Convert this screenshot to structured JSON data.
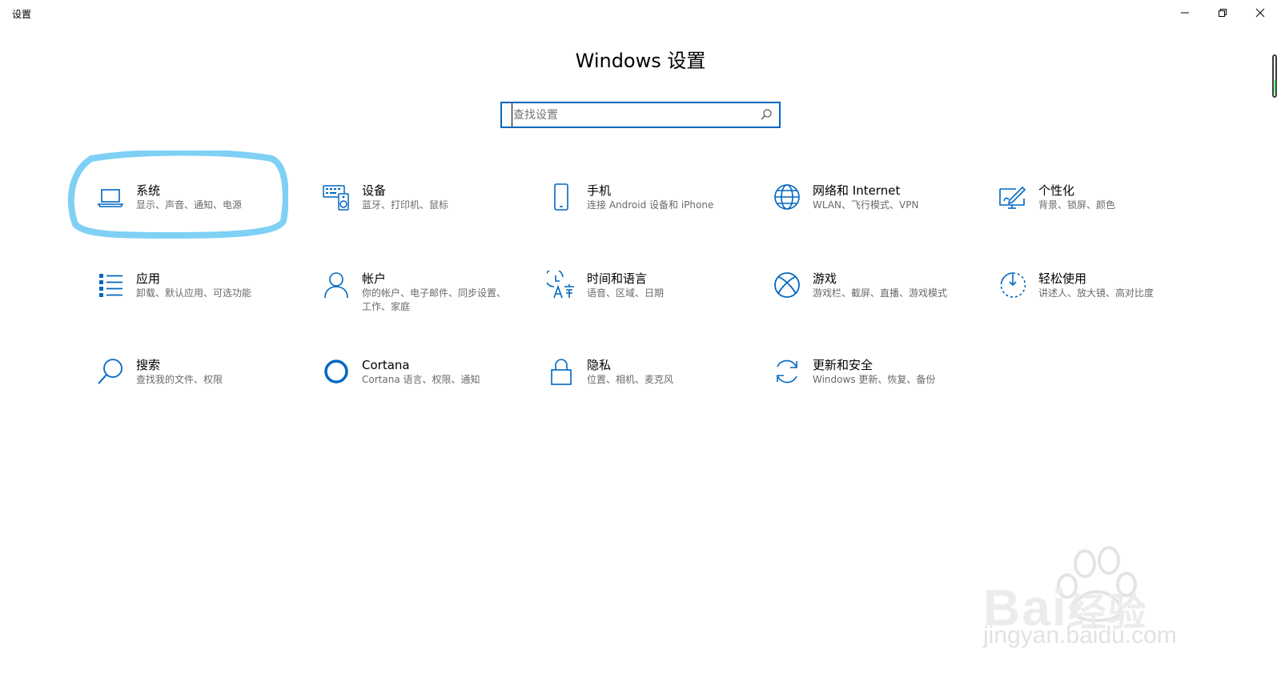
{
  "window": {
    "title": "设置"
  },
  "page": {
    "title": "Windows 设置"
  },
  "search": {
    "placeholder": "查找设置",
    "value": ""
  },
  "tiles": [
    {
      "name": "系统",
      "desc": "显示、声音、通知、电源",
      "icon": "laptop-icon"
    },
    {
      "name": "设备",
      "desc": "蓝牙、打印机、鼠标",
      "icon": "keyboard-speaker-icon"
    },
    {
      "name": "手机",
      "desc": "连接 Android 设备和 iPhone",
      "icon": "phone-icon"
    },
    {
      "name": "网络和 Internet",
      "desc": "WLAN、飞行模式、VPN",
      "icon": "globe-icon"
    },
    {
      "name": "个性化",
      "desc": "背景、锁屏、颜色",
      "icon": "paint-pen-icon"
    },
    {
      "name": "应用",
      "desc": "卸载、默认应用、可选功能",
      "icon": "apps-list-icon"
    },
    {
      "name": "帐户",
      "desc": "你的帐户、电子邮件、同步设置、工作、家庭",
      "icon": "person-icon"
    },
    {
      "name": "时间和语言",
      "desc": "语音、区域、日期",
      "icon": "time-language-icon"
    },
    {
      "name": "游戏",
      "desc": "游戏栏、截屏、直播、游戏模式",
      "icon": "xbox-icon"
    },
    {
      "name": "轻松使用",
      "desc": "讲述人、放大镜、高对比度",
      "icon": "ease-of-access-icon"
    },
    {
      "name": "搜索",
      "desc": "查找我的文件、权限",
      "icon": "search-icon"
    },
    {
      "name": "Cortana",
      "desc": "Cortana 语言、权限、通知",
      "icon": "cortana-icon"
    },
    {
      "name": "隐私",
      "desc": "位置、相机、麦克风",
      "icon": "lock-icon"
    },
    {
      "name": "更新和安全",
      "desc": "Windows 更新、恢复、备份",
      "icon": "refresh-icon"
    }
  ],
  "colors": {
    "accent": "#0067c0",
    "highlight": "#7fd0f5",
    "description": "#6a6a6a"
  },
  "watermark": {
    "domain": "jingyan.baidu.com",
    "brand": "Bai",
    "brand_suffix": "经验"
  }
}
